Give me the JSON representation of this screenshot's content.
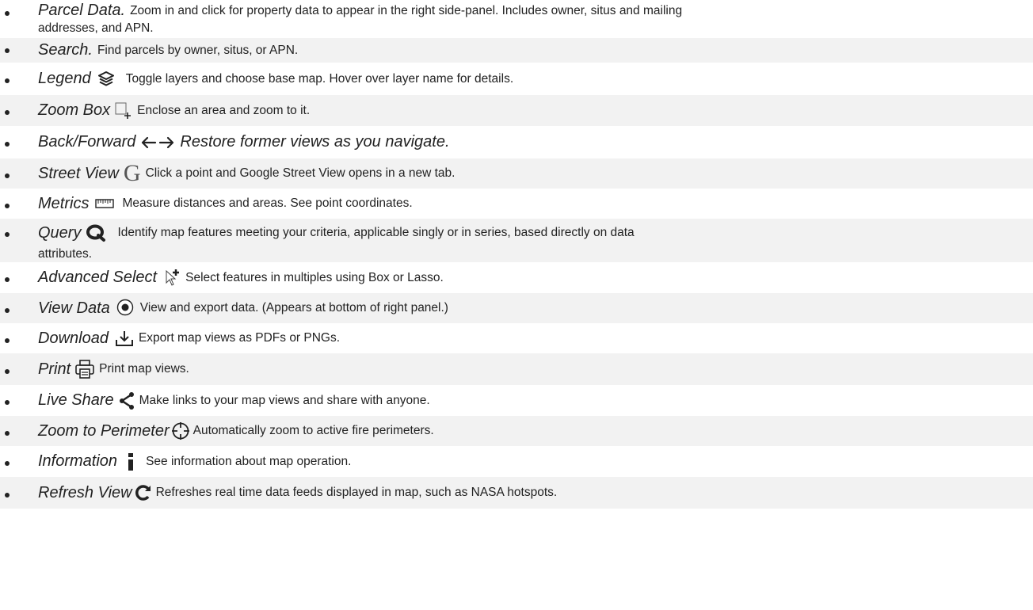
{
  "items": [
    {
      "title": "Parcel Data.",
      "desc": "Zoom in and click for property data to appear in the right side-panel.  Includes owner, situs and mailing",
      "desc2": "addresses, and APN.",
      "icon": "none"
    },
    {
      "title": "Search.",
      "desc": "Find parcels by owner, situs, or APN.",
      "icon": "none"
    },
    {
      "title": "Legend",
      "desc": "Toggle layers and choose base map.  Hover over layer name for details.",
      "icon": "layers-icon"
    },
    {
      "title": "Zoom Box",
      "desc": "Enclose an area and zoom to it.",
      "icon": "zoom-box-icon"
    },
    {
      "title": "Back/Forward",
      "desc": "Restore former views as you navigate.",
      "icon": "back-forward-arrows-icon"
    },
    {
      "title": "Street View",
      "desc": "Click a point and Google Street View opens in a new tab.",
      "icon": "google-g-icon"
    },
    {
      "title": "Metrics",
      "desc": "Measure distances and areas. See point coordinates.",
      "icon": "ruler-icon"
    },
    {
      "title": "Query",
      "desc": "Identify map features meeting your criteria, applicable singly or in series, based directly on data",
      "desc2": "attributes.",
      "icon": "query-icon"
    },
    {
      "title": "Advanced Select",
      "desc": "Select features in multiples using Box or Lasso.",
      "icon": "advanced-select-cursor-icon"
    },
    {
      "title": "View Data",
      "desc": "View and export data.  (Appears at bottom of right panel.)",
      "icon": "eye-icon"
    },
    {
      "title": "Download",
      "desc": "Export map views as PDFs or PNGs.",
      "icon": "download-icon"
    },
    {
      "title": "Print",
      "desc": "Print map views.",
      "icon": "printer-icon"
    },
    {
      "title": "Live Share",
      "desc": "Make links to your map views and share with anyone.",
      "icon": "share-icon"
    },
    {
      "title": "Zoom to Perimeter",
      "desc": "Automatically zoom to active fire perimeters.",
      "icon": "crosshair-icon"
    },
    {
      "title": "Information",
      "desc": "See information about map operation.",
      "icon": "info-icon"
    },
    {
      "title": "Refresh View",
      "desc": "Refreshes real time data feeds displayed in map, such as NASA hotspots.",
      "icon": "refresh-icon"
    }
  ]
}
